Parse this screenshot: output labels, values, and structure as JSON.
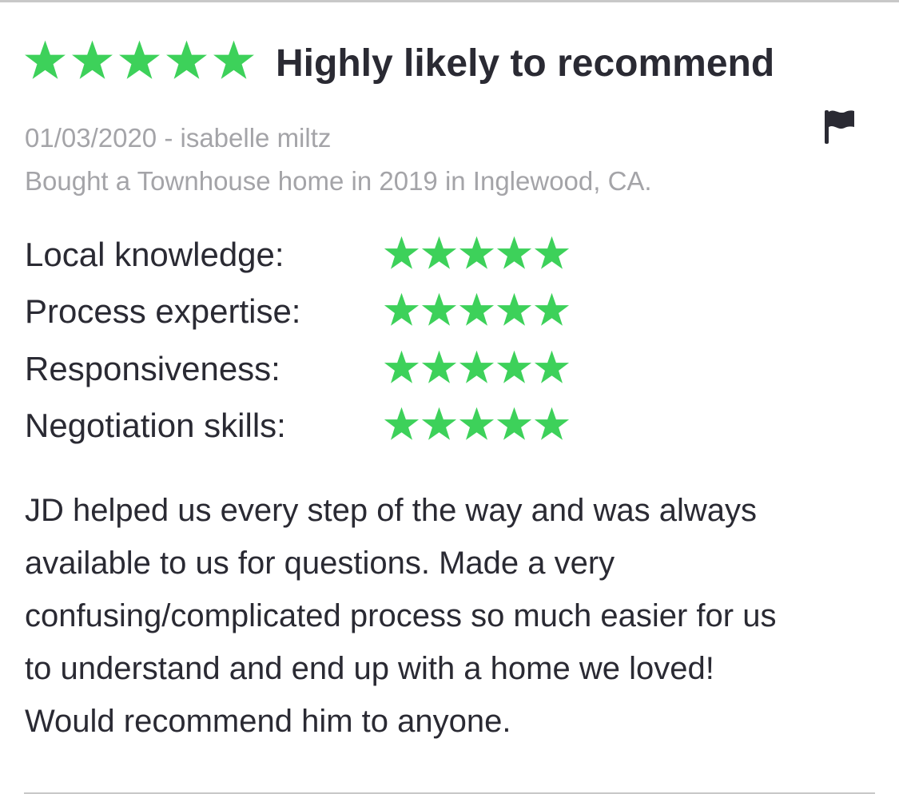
{
  "review": {
    "overall_rating": 5,
    "overall_max": 5,
    "headline": "Highly likely to recommend",
    "date": "01/03/2020",
    "author": "isabelle miltz",
    "date_author_line": "01/03/2020 - isabelle miltz",
    "transaction": "Bought a Townhouse home in 2019 in Inglewood, CA.",
    "flag_icon": "flag-icon",
    "star_icon": "star-icon",
    "star_color": "#3dd15a",
    "categories": [
      {
        "label": "Local knowledge:",
        "rating": 5
      },
      {
        "label": "Process expertise:",
        "rating": 5
      },
      {
        "label": "Responsiveness:",
        "rating": 5
      },
      {
        "label": "Negotiation skills:",
        "rating": 5
      }
    ],
    "body_lines": [
      "JD helped us every step of the way and was always",
      "available to us for questions. Made a very",
      "confusing/complicated process so much easier for us",
      "to understand and end up with a home we loved!",
      "Would recommend him to anyone."
    ]
  }
}
